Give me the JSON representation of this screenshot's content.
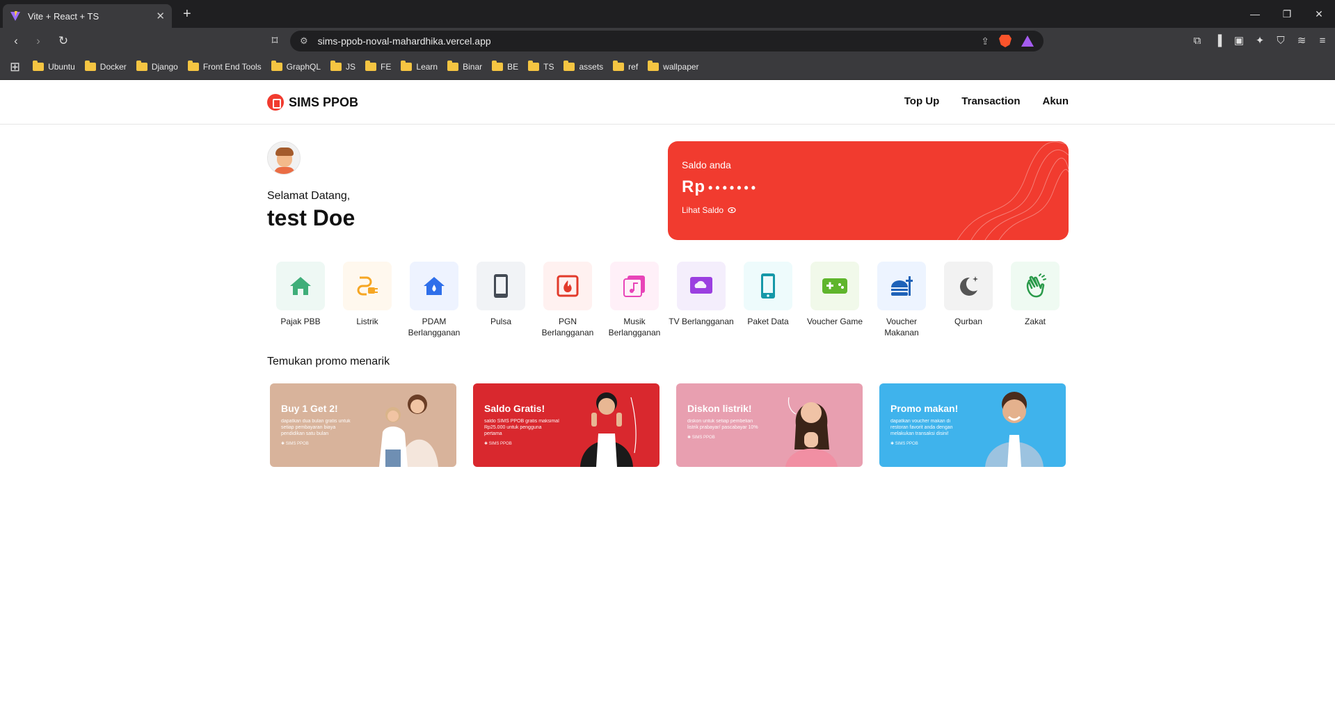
{
  "browser": {
    "tab_title": "Vite + React + TS",
    "tab_close": "✕",
    "new_tab": "+",
    "url": "sims-ppob-noval-mahardhika.vercel.app",
    "win_minimize": "—",
    "win_restore": "❐",
    "win_close": "✕",
    "bookmarks": [
      "Ubuntu",
      "Docker",
      "Django",
      "Front End Tools",
      "GraphQL",
      "JS",
      "FE",
      "Learn",
      "Binar",
      "BE",
      "TS",
      "assets",
      "ref",
      "wallpaper"
    ]
  },
  "app": {
    "logo_text": "SIMS PPOB",
    "nav": {
      "topup": "Top Up",
      "transaction": "Transaction",
      "akun": "Akun"
    },
    "welcome": "Selamat Datang,",
    "username": "test Doe",
    "saldo": {
      "label": "Saldo anda",
      "currency": "Rp",
      "masked": "•••••••",
      "toggle_label": "Lihat Saldo"
    },
    "services": [
      {
        "label": "Pajak PBB",
        "icon": "house-icon",
        "bg": "#eef8f4",
        "color": "#3fae79"
      },
      {
        "label": "Listrik",
        "icon": "plug-icon",
        "bg": "#fff8ee",
        "color": "#f6a623"
      },
      {
        "label": "PDAM Berlangganan",
        "icon": "water-house-icon",
        "bg": "#eef3ff",
        "color": "#2f6fea"
      },
      {
        "label": "Pulsa",
        "icon": "phone-icon",
        "bg": "#f1f3f6",
        "color": "#444b55"
      },
      {
        "label": "PGN Berlangganan",
        "icon": "gas-fire-icon",
        "bg": "#fff1f0",
        "color": "#e23a2b"
      },
      {
        "label": "Musik Berlangganan",
        "icon": "music-icon",
        "bg": "#fff0f8",
        "color": "#e845b8"
      },
      {
        "label": "TV Berlangganan",
        "icon": "tv-cloud-icon",
        "bg": "#f4eefc",
        "color": "#9b3fe0"
      },
      {
        "label": "Paket Data",
        "icon": "mobile-data-icon",
        "bg": "#eefbfc",
        "color": "#1698a8"
      },
      {
        "label": "Voucher Game",
        "icon": "gamepad-icon",
        "bg": "#f1f9ea",
        "color": "#5fb52c"
      },
      {
        "label": "Voucher Makanan",
        "icon": "food-icon",
        "bg": "#edf4ff",
        "color": "#1e62b8"
      },
      {
        "label": "Qurban",
        "icon": "moon-icon",
        "bg": "#f2f2f2",
        "color": "#555555"
      },
      {
        "label": "Zakat",
        "icon": "hand-wave-icon",
        "bg": "#effaf2",
        "color": "#2a9a4a"
      }
    ],
    "promo_title": "Temukan promo menarik",
    "promos": [
      {
        "title": "Buy 1 Get 2!",
        "desc": "dapatkan dua bulan gratis untuk setiap pembayaran biaya pendidikan satu bulan",
        "brand": "✱ SIMS PPOB",
        "bg": "#d8b39b"
      },
      {
        "title": "Saldo Gratis!",
        "desc": "saldo SIMS PPOB gratis maksimal Rp25.000 untuk pengguna pertama",
        "brand": "✱ SIMS PPOB",
        "bg": "#d9282e"
      },
      {
        "title": "Diskon listrik!",
        "desc": "diskon untuk setiap pembelian listrik prabayar/ pascabayar 10%",
        "brand": "✱ SIMS PPOB",
        "bg": "#e89fb0"
      },
      {
        "title": "Promo makan!",
        "desc": "dapatkan voucher makan di restoran favorit anda dengan melakukan transaksi disini!",
        "brand": "✱ SIMS PPOB",
        "bg": "#3fb3ec"
      }
    ]
  }
}
